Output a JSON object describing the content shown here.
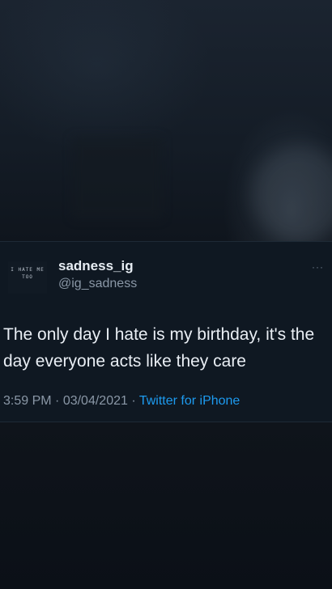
{
  "tweet": {
    "avatar_text": "I HATE ME TOO",
    "name": "sadness_ig",
    "handle": "@ig_sadness",
    "more_icon": "more-dots-icon",
    "text": "The only day I hate is my birthday, it's the day everyone acts like they care",
    "time": "3:59 PM",
    "separator": " · ",
    "date": "03/04/2021",
    "source": "Twitter for iPhone"
  },
  "colors": {
    "source_link": "#1d9bf0",
    "tweet_bg": "#0f1822"
  }
}
